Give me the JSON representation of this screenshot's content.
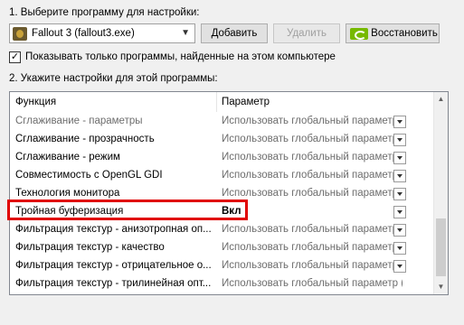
{
  "step1_label": "1. Выберите программу для настройки:",
  "program_select": {
    "value": "Fallout 3 (fallout3.exe)",
    "icon": "fallout-icon"
  },
  "buttons": {
    "add": "Добавить",
    "remove": "Удалить",
    "restore": "Восстановить"
  },
  "filter_checkbox": {
    "label": "Показывать только программы, найденные на этом компьютере",
    "checked": true
  },
  "step2_label": "2. Укажите настройки для этой программы:",
  "table": {
    "headers": {
      "function": "Функция",
      "parameter": "Параметр"
    },
    "rows": [
      {
        "function": "Сглаживание - параметры",
        "value": "Использовать глобальный параметр (У...",
        "disabled": true
      },
      {
        "function": "Сглаживание - прозрачность",
        "value": "Использовать глобальный параметр (В..."
      },
      {
        "function": "Сглаживание - режим",
        "value": "Использовать глобальный параметр (У..."
      },
      {
        "function": "Совместимость с OpenGL GDI",
        "value": "Использовать глобальный параметр (А..."
      },
      {
        "function": "Технология монитора",
        "value": "Использовать глобальный параметр (П..."
      },
      {
        "function": "Тройная буферизация",
        "value": "Вкл",
        "highlighted": true
      },
      {
        "function": "Фильтрация текстур - анизотропная оп...",
        "value": "Использовать глобальный параметр (В..."
      },
      {
        "function": "Фильтрация текстур - качество",
        "value": "Использовать глобальный параметр (К..."
      },
      {
        "function": "Фильтрация текстур - отрицательное о...",
        "value": "Использовать глобальный параметр (Р..."
      },
      {
        "function": "Фильтрация текстур - трилинейная опт...",
        "value": "Использовать глобальный параметр (Вкл)"
      }
    ]
  },
  "colors": {
    "highlight_border": "#e00000",
    "nvidia_green": "#76b900"
  }
}
